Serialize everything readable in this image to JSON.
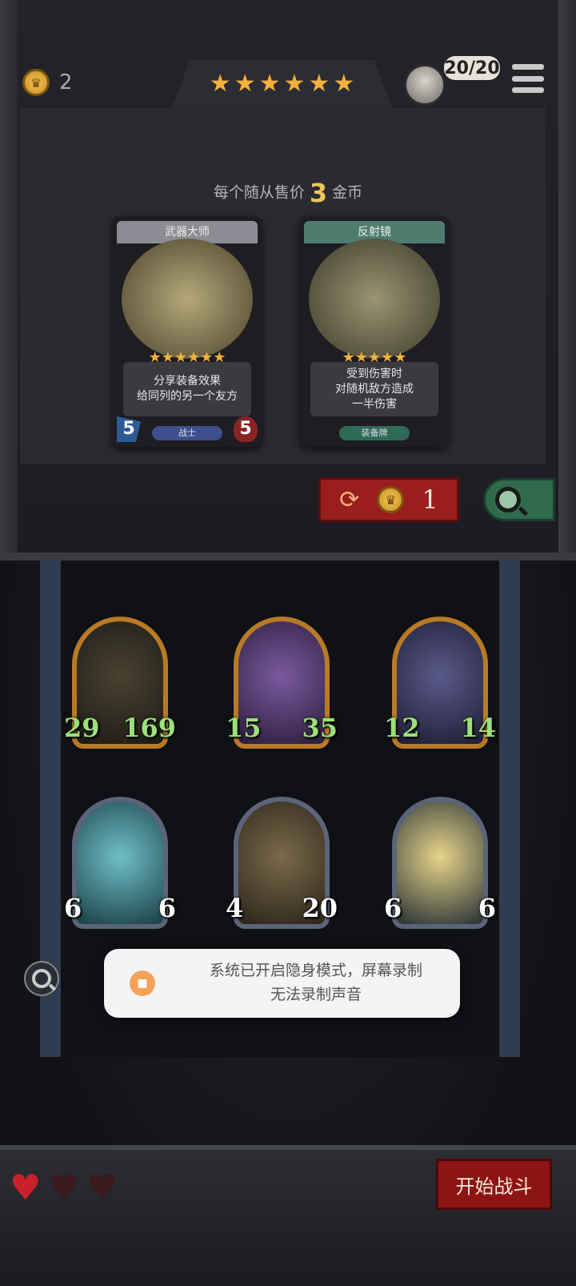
{
  "header": {
    "coins": "2",
    "tavern_stars": 6,
    "hero_count": "20/20"
  },
  "shop": {
    "sell_prefix": "每个随从售价",
    "sell_price": "3",
    "sell_suffix": "金币",
    "cards": [
      {
        "title": "武器大师",
        "stars": 6,
        "desc_lines": [
          "分享装备效果",
          "给同列的另一个友方"
        ],
        "tag": "战士",
        "attack": "5",
        "health": "5"
      },
      {
        "title": "反射镜",
        "stars": 5,
        "desc_lines": [
          "受到伤害时",
          "对随机敌方造成",
          "一半伤害"
        ],
        "tag": "装备牌"
      }
    ],
    "refresh_cost": "1"
  },
  "board": {
    "minions": [
      {
        "attack": "29",
        "health": "169",
        "frame": "gold"
      },
      {
        "attack": "15",
        "health": "35",
        "frame": "gold"
      },
      {
        "attack": "12",
        "health": "14",
        "frame": "gold"
      },
      {
        "attack": "6",
        "health": "6",
        "frame": "silver"
      },
      {
        "attack": "4",
        "health": "20",
        "frame": "silver"
      },
      {
        "attack": "6",
        "health": "6",
        "frame": "silver"
      }
    ]
  },
  "toast": {
    "line1": "系统已开启隐身模式，屏幕录制",
    "line2": "无法录制声音"
  },
  "footer": {
    "lives_total": 3,
    "lives_remaining": 1,
    "start_battle_label": "开始战斗"
  },
  "colors": {
    "star": "#f3b13b",
    "gold_stat": "#9be07a",
    "button_red": "#8e1414"
  }
}
